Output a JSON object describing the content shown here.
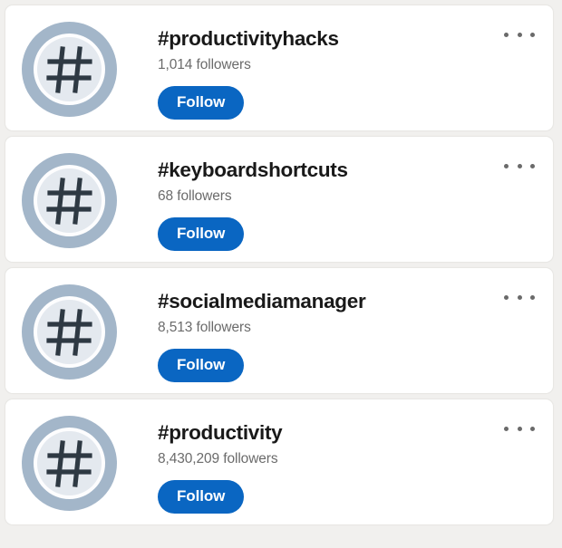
{
  "page": {
    "background_color": "#f1f0ee",
    "card_background_color": "#ffffff",
    "accent_color": "#0a66c2",
    "avatar_ring_color": "#a3b6c9",
    "avatar_inner_color": "#e4e9ef",
    "hashtag_glyph_color": "#2e3943",
    "overflow_icon_name": "overflow-menu-icon",
    "avatar_icon_name": "hashtag-avatar-icon"
  },
  "cards": [
    {
      "hashtag": "#productivityhacks",
      "followers": "1,014 followers",
      "follow_label": "Follow"
    },
    {
      "hashtag": "#keyboardshortcuts",
      "followers": "68 followers",
      "follow_label": "Follow"
    },
    {
      "hashtag": "#socialmediamanager",
      "followers": "8,513 followers",
      "follow_label": "Follow"
    },
    {
      "hashtag": "#productivity",
      "followers": "8,430,209 followers",
      "follow_label": "Follow"
    }
  ]
}
